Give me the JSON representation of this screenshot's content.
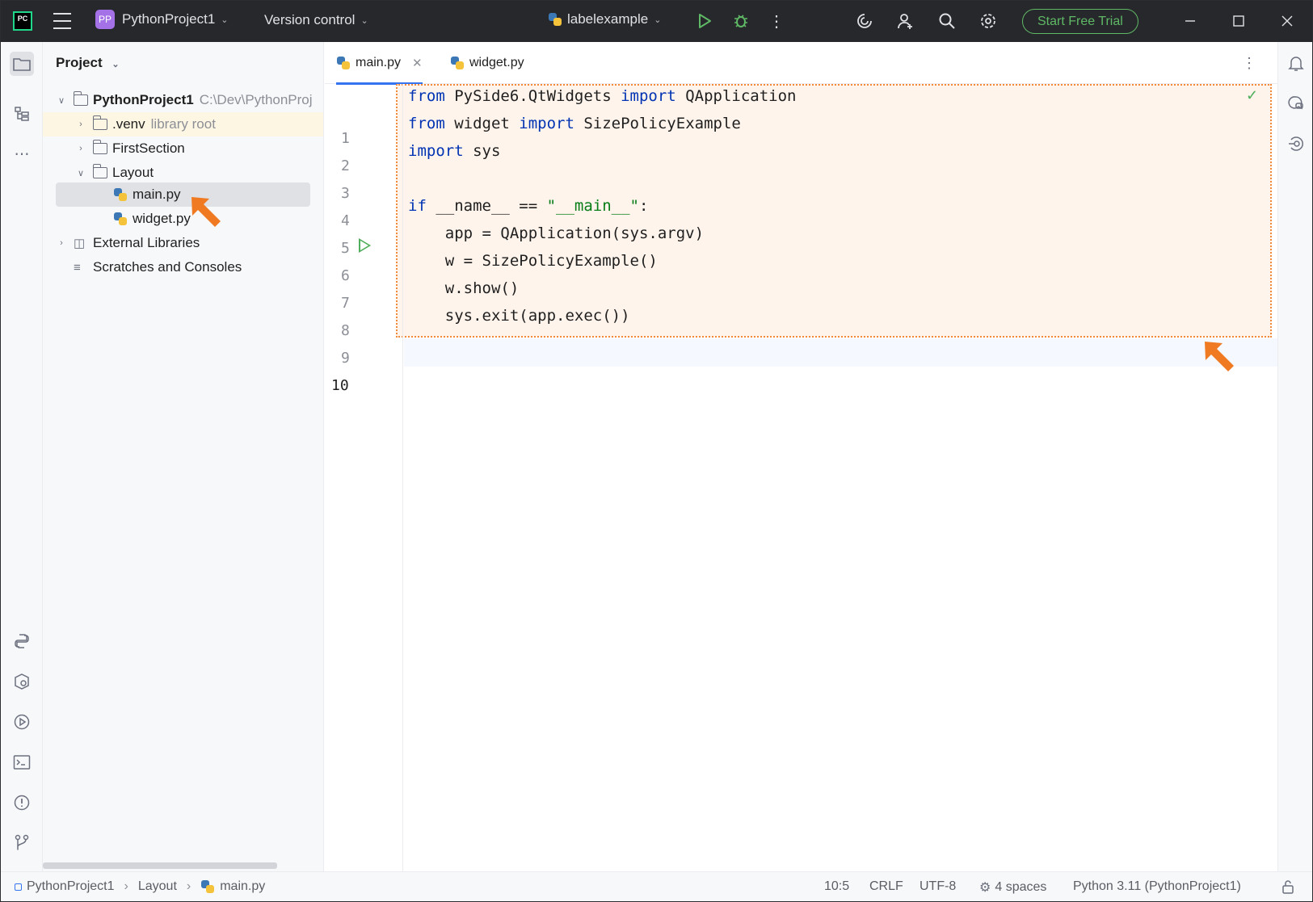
{
  "titlebar": {
    "logo_text": "PC",
    "project_badge": "PP",
    "project_name": "PythonProject1",
    "vcs_label": "Version control",
    "run_config": "labelexample",
    "trial_button": "Start Free Trial"
  },
  "project_panel": {
    "title": "Project",
    "tree": {
      "root_name": "PythonProject1",
      "root_path": "C:\\Dev\\PythonProj",
      "venv_name": ".venv",
      "venv_hint": "library root",
      "first_section": "FirstSection",
      "layout": "Layout",
      "main_file": "main.py",
      "widget_file": "widget.py",
      "external_libraries": "External Libraries",
      "scratches": "Scratches and Consoles"
    }
  },
  "editor": {
    "tabs": [
      {
        "label": "main.py",
        "active": true
      },
      {
        "label": "widget.py",
        "active": false
      }
    ],
    "line_numbers": [
      "1",
      "2",
      "3",
      "4",
      "5",
      "6",
      "7",
      "8",
      "9",
      "10"
    ],
    "current_line": 10,
    "run_gutter_line": 5,
    "code": {
      "l1_kw1": "from",
      "l1_mod": " PySide6.QtWidgets ",
      "l1_kw2": "import",
      "l1_name": " QApplication",
      "l2_kw1": "from",
      "l2_mod": " widget ",
      "l2_kw2": "import",
      "l2_name": " SizePolicyExample",
      "l3_kw": "import",
      "l3_name": " sys",
      "l5_kw": "if",
      "l5_mid": " __name__ == ",
      "l5_str": "\"__main__\"",
      "l5_end": ":",
      "l6": "    app = QApplication(sys.argv)",
      "l7": "    w = SizePolicyExample()",
      "l8": "    w.show()",
      "l9": "    sys.exit(app.exec())"
    }
  },
  "statusbar": {
    "breadcrumb_project": "PythonProject1",
    "breadcrumb_folder": "Layout",
    "breadcrumb_file": "main.py",
    "caret": "10:5",
    "line_sep": "CRLF",
    "encoding": "UTF-8",
    "indent": "4 spaces",
    "interpreter": "Python 3.11 (PythonProject1)"
  },
  "colors": {
    "accent": "#3574f0",
    "highlight_border": "#f08a3a",
    "keyword": "#0033b3",
    "string": "#067d17",
    "trial": "#5fb865"
  },
  "icons": [
    "menu-icon",
    "chevron-down-icon",
    "python-icon",
    "run-icon",
    "debug-icon",
    "more-vertical-icon",
    "ai-assistant-icon",
    "add-user-icon",
    "search-icon",
    "gear-icon",
    "minimize-icon",
    "maximize-icon",
    "close-icon",
    "folder-icon",
    "structure-icon",
    "more-horizontal-icon",
    "python-console-icon",
    "python-packages-icon",
    "services-icon",
    "terminal-icon",
    "problems-icon",
    "git-icon",
    "notifications-icon",
    "ai-chat-icon",
    "coverage-icon",
    "lock-icon",
    "check-icon"
  ]
}
